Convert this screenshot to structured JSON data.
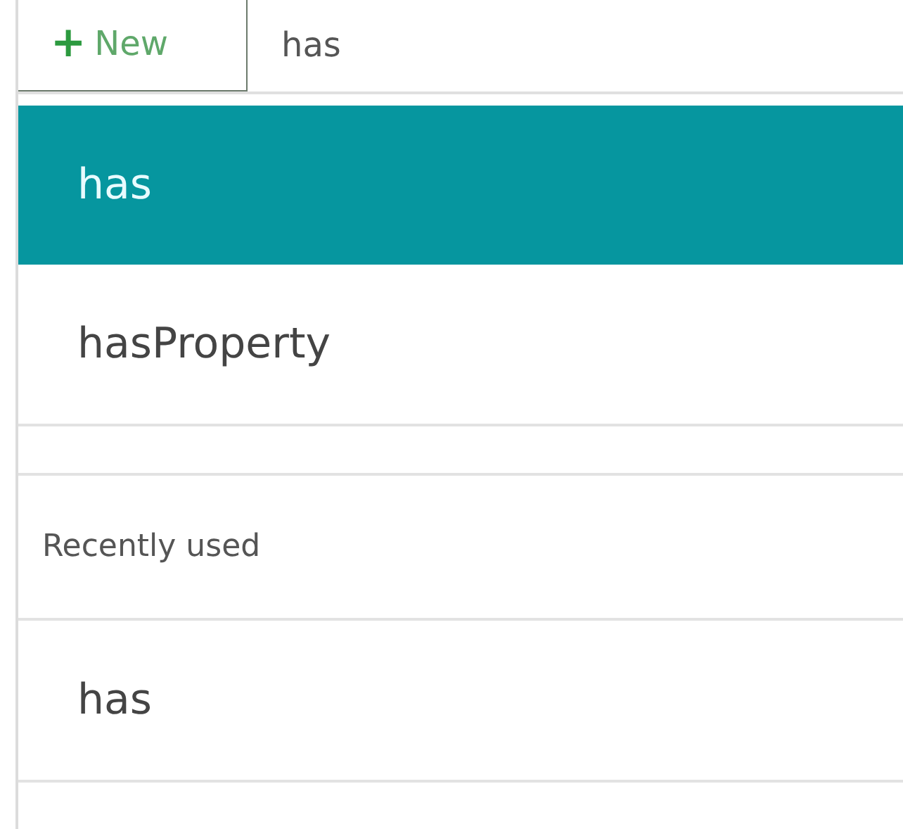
{
  "toolbar": {
    "new_button": {
      "icon": "+",
      "label": "New"
    },
    "search": {
      "value": "has"
    }
  },
  "results": [
    {
      "label": "has",
      "selected": true
    },
    {
      "label": "hasProperty",
      "selected": false
    }
  ],
  "recent": {
    "heading": "Recently used",
    "items": [
      {
        "label": "has",
        "selected": false
      }
    ]
  }
}
